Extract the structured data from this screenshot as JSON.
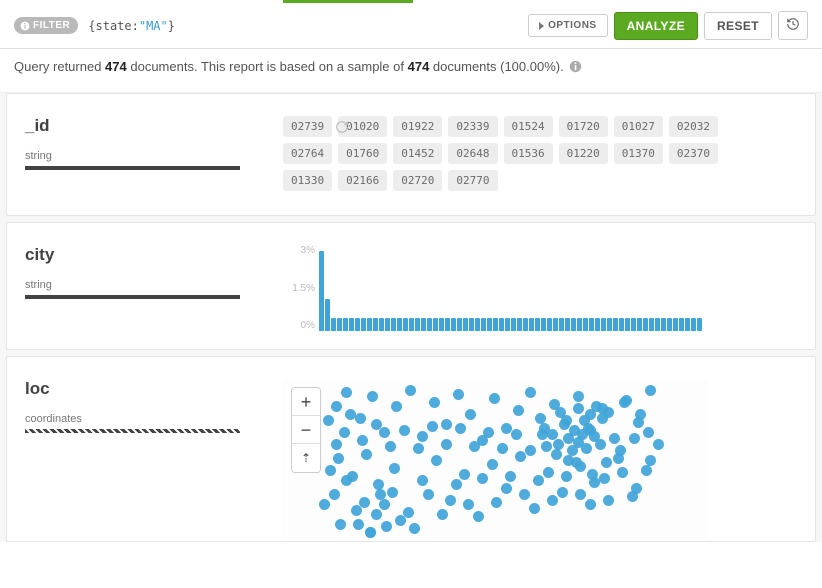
{
  "toolbar": {
    "filter_label": "FILTER",
    "query": {
      "key": "state",
      "value": "\"MA\""
    },
    "options_label": "OPTIONS",
    "analyze_label": "ANALYZE",
    "reset_label": "RESET"
  },
  "summary": {
    "prefix": "Query returned ",
    "count1": "474",
    "mid": " documents. This report is based on a sample of ",
    "count2": "474",
    "suffix": " documents (100.00%)."
  },
  "fields": {
    "id": {
      "name": "_id",
      "type": "string",
      "samples": [
        "02739",
        "01020",
        "01922",
        "02339",
        "01524",
        "01720",
        "01027",
        "02032",
        "02764",
        "01760",
        "01452",
        "02648",
        "01536",
        "01220",
        "01370",
        "02370",
        "01330",
        "02166",
        "02720",
        "02770"
      ]
    },
    "city": {
      "name": "city",
      "type": "string"
    },
    "loc": {
      "name": "loc",
      "type": "coordinates"
    }
  },
  "chart_data": {
    "type": "bar",
    "title": "",
    "xlabel": "",
    "ylabel": "",
    "ylim": [
      0,
      3
    ],
    "yticks": [
      "3%",
      "1.5%",
      "0%"
    ],
    "values": [
      3,
      1.2,
      0.5,
      0.5,
      0.5,
      0.5,
      0.5,
      0.5,
      0.5,
      0.5,
      0.5,
      0.5,
      0.5,
      0.5,
      0.5,
      0.5,
      0.5,
      0.5,
      0.5,
      0.5,
      0.5,
      0.5,
      0.5,
      0.5,
      0.5,
      0.5,
      0.5,
      0.5,
      0.5,
      0.5,
      0.5,
      0.5,
      0.5,
      0.5,
      0.5,
      0.5,
      0.5,
      0.5,
      0.5,
      0.5,
      0.5,
      0.5,
      0.5,
      0.5,
      0.5,
      0.5,
      0.5,
      0.5,
      0.5,
      0.5,
      0.5,
      0.5,
      0.5,
      0.5,
      0.5,
      0.5,
      0.5,
      0.5,
      0.5,
      0.5,
      0.5,
      0.5,
      0.5,
      0.5
    ]
  },
  "loc_points": [
    [
      58,
      8
    ],
    [
      72,
      34
    ],
    [
      84,
      12
    ],
    [
      96,
      48
    ],
    [
      108,
      22
    ],
    [
      122,
      6
    ],
    [
      134,
      52
    ],
    [
      146,
      18
    ],
    [
      158,
      40
    ],
    [
      170,
      10
    ],
    [
      182,
      30
    ],
    [
      194,
      56
    ],
    [
      206,
      14
    ],
    [
      218,
      44
    ],
    [
      230,
      26
    ],
    [
      242,
      8
    ],
    [
      254,
      50
    ],
    [
      266,
      20
    ],
    [
      278,
      36
    ],
    [
      290,
      12
    ],
    [
      302,
      46
    ],
    [
      314,
      24
    ],
    [
      326,
      54
    ],
    [
      338,
      16
    ],
    [
      350,
      38
    ],
    [
      362,
      6
    ],
    [
      50,
      74
    ],
    [
      64,
      92
    ],
    [
      78,
      70
    ],
    [
      92,
      110
    ],
    [
      106,
      84
    ],
    [
      120,
      128
    ],
    [
      134,
      96
    ],
    [
      148,
      76
    ],
    [
      162,
      116
    ],
    [
      176,
      90
    ],
    [
      190,
      132
    ],
    [
      204,
      80
    ],
    [
      218,
      104
    ],
    [
      232,
      72
    ],
    [
      246,
      124
    ],
    [
      260,
      88
    ],
    [
      274,
      108
    ],
    [
      288,
      78
    ],
    [
      302,
      120
    ],
    [
      316,
      94
    ],
    [
      330,
      74
    ],
    [
      344,
      112
    ],
    [
      358,
      86
    ],
    [
      52,
      140
    ],
    [
      68,
      126
    ],
    [
      82,
      148
    ],
    [
      290,
      24
    ],
    [
      296,
      36
    ],
    [
      302,
      30
    ],
    [
      308,
      22
    ],
    [
      314,
      34
    ],
    [
      320,
      28
    ],
    [
      300,
      44
    ],
    [
      294,
      50
    ],
    [
      286,
      46
    ],
    [
      280,
      54
    ],
    [
      306,
      52
    ],
    [
      312,
      60
    ],
    [
      298,
      64
    ],
    [
      290,
      58
    ],
    [
      284,
      66
    ],
    [
      276,
      40
    ],
    [
      272,
      28
    ],
    [
      264,
      50
    ],
    [
      258,
      62
    ],
    [
      252,
      34
    ],
    [
      268,
      70
    ],
    [
      280,
      76
    ],
    [
      292,
      82
    ],
    [
      304,
      90
    ],
    [
      318,
      78
    ],
    [
      332,
      66
    ],
    [
      346,
      54
    ],
    [
      360,
      48
    ],
    [
      90,
      100
    ],
    [
      96,
      120
    ],
    [
      104,
      108
    ],
    [
      88,
      130
    ],
    [
      76,
      118
    ],
    [
      70,
      140
    ],
    [
      82,
      148
    ],
    [
      98,
      142
    ],
    [
      112,
      136
    ],
    [
      126,
      144
    ],
    [
      140,
      110
    ],
    [
      154,
      130
    ],
    [
      168,
      100
    ],
    [
      180,
      120
    ],
    [
      194,
      94
    ],
    [
      208,
      118
    ],
    [
      222,
      92
    ],
    [
      236,
      110
    ],
    [
      250,
      96
    ],
    [
      264,
      116
    ],
    [
      278,
      92
    ],
    [
      292,
      110
    ],
    [
      306,
      98
    ],
    [
      320,
      116
    ],
    [
      334,
      88
    ],
    [
      348,
      104
    ],
    [
      362,
      76
    ],
    [
      370,
      60
    ],
    [
      352,
      30
    ],
    [
      336,
      18
    ],
    [
      48,
      60
    ],
    [
      56,
      48
    ],
    [
      62,
      30
    ],
    [
      74,
      56
    ],
    [
      88,
      40
    ],
    [
      102,
      62
    ],
    [
      116,
      46
    ],
    [
      130,
      64
    ],
    [
      144,
      42
    ],
    [
      158,
      60
    ],
    [
      172,
      44
    ],
    [
      186,
      62
    ],
    [
      200,
      48
    ],
    [
      214,
      64
    ],
    [
      228,
      50
    ],
    [
      242,
      66
    ],
    [
      256,
      44
    ],
    [
      270,
      60
    ],
    [
      46,
      110
    ],
    [
      58,
      96
    ],
    [
      48,
      22
    ],
    [
      40,
      36
    ],
    [
      42,
      86
    ],
    [
      36,
      120
    ]
  ],
  "map_controls": {
    "zoom_in": "+",
    "zoom_out": "−",
    "reset_bearing": "⇡"
  }
}
